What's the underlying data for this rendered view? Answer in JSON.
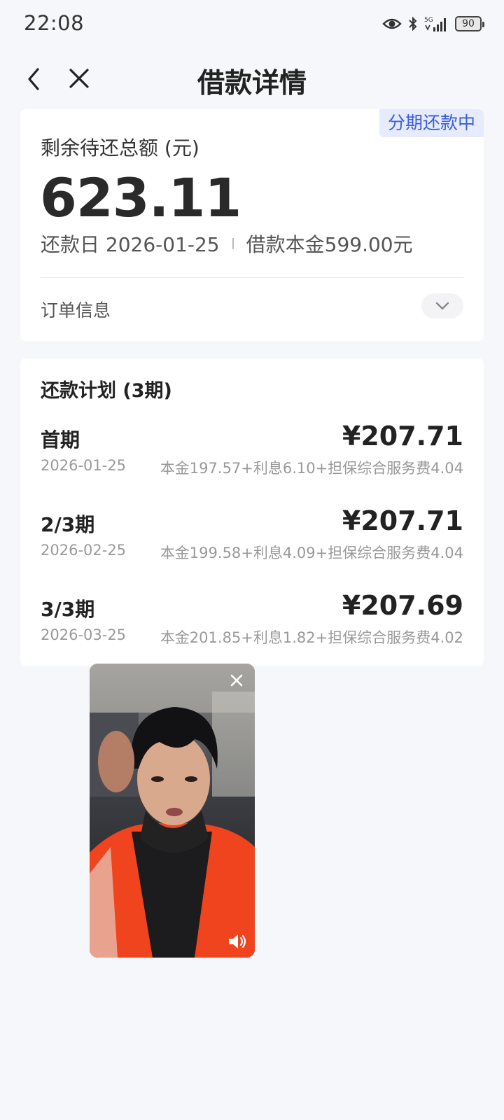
{
  "status_bar": {
    "time": "22:08",
    "network": "5G",
    "battery": "90"
  },
  "nav": {
    "title": "借款详情"
  },
  "summary": {
    "status_tag": "分期还款中",
    "remaining_label": "剩余待还总额 (元)",
    "remaining_amount": "623.11",
    "repay_date": "还款日 2026-01-25",
    "principal": "借款本金599.00元",
    "order_info_label": "订单信息"
  },
  "plan": {
    "title": "还款计划 (3期)",
    "rows": [
      {
        "name": "首期",
        "date": "2026-01-25",
        "amount": "¥207.71",
        "detail": "本金197.57+利息6.10+担保综合服务费4.04"
      },
      {
        "name": "2/3期",
        "date": "2026-02-25",
        "amount": "¥207.71",
        "detail": "本金199.58+利息4.09+担保综合服务费4.04"
      },
      {
        "name": "3/3期",
        "date": "2026-03-25",
        "amount": "¥207.69",
        "detail": "本金201.85+利息1.82+担保综合服务费4.02"
      }
    ]
  },
  "colors": {
    "accent": "#3c5fd8",
    "tag_bg": "#e6ebff",
    "page_bg": "#f6f7fb"
  }
}
